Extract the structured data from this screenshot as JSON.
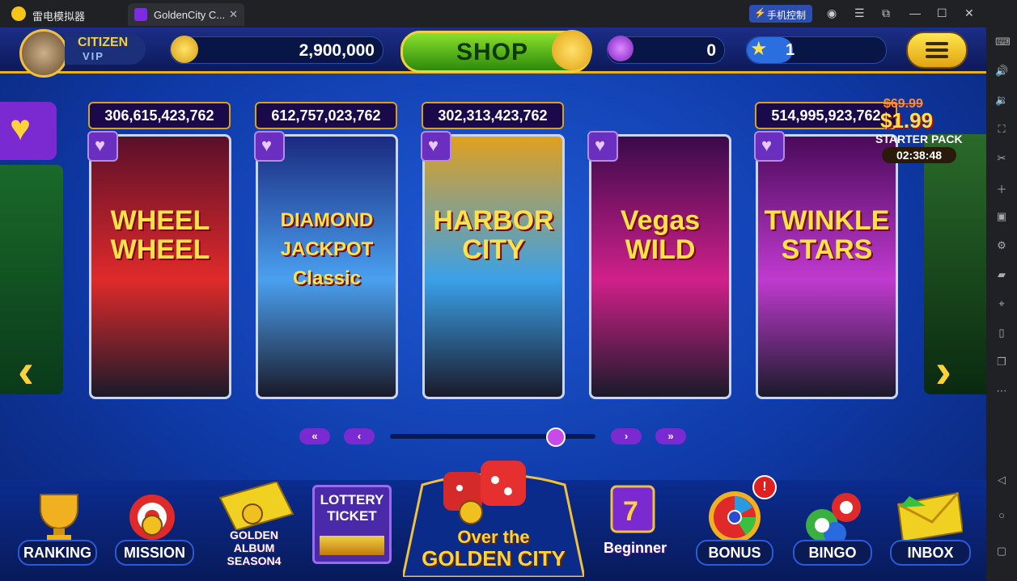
{
  "window": {
    "app_name": "雷电模拟器",
    "tab_title": "GoldenCity C...",
    "phone_control": "手机控制"
  },
  "topbar": {
    "rank_title": "CITIZEN",
    "rank_tier": "VIP",
    "coins": "2,900,000",
    "shop_label": "SHOP",
    "gems": "0",
    "level": "1",
    "level_progress": 0.33
  },
  "cards": [
    {
      "jackpot": "306,615,423,762",
      "title": "WHEEL WHEEL",
      "colors": [
        "#5a0f2a",
        "#e02a2a"
      ]
    },
    {
      "jackpot": "612,757,023,762",
      "title": "DIAMOND JACKPOT Classic",
      "colors": [
        "#1a2a80",
        "#4aa0f0"
      ]
    },
    {
      "jackpot": "302,313,423,762",
      "title": "HARBOR CITY",
      "colors": [
        "#e0a020",
        "#3aa0e8"
      ]
    },
    {
      "jackpot": "",
      "title": "Vegas WILD",
      "colors": [
        "#3a0a4a",
        "#d0208a"
      ]
    },
    {
      "jackpot": "514,995,923,762",
      "title": "TWINKLE STARS",
      "colors": [
        "#4a0a5a",
        "#c03ad0"
      ]
    }
  ],
  "offer": {
    "old_price": "$69.99",
    "price": "$1.99",
    "label": "STARTER PACK",
    "timer": "02:38:48"
  },
  "pager": {
    "first": "«",
    "prev": "‹",
    "next": "›",
    "last": "»",
    "position": 0.8
  },
  "bottom_nav": {
    "ranking": "RANKING",
    "mission": "MISSION",
    "album": "GOLDEN ALBUM SEASON4",
    "lottery": "LOTTERY TICKET",
    "center_top": "Over the",
    "center": "GOLDEN CITY",
    "beginner": "Beginner",
    "bonus": "BONUS",
    "bonus_badge": "!",
    "bingo": "BINGO",
    "inbox": "INBOX"
  },
  "icons": [
    "star-icon",
    "heart-icon",
    "coin-icon",
    "gem-icon",
    "menu-icon",
    "trophy-icon",
    "dice-icon",
    "wheel-icon",
    "envelope-icon",
    "bingo-ball-icon"
  ]
}
